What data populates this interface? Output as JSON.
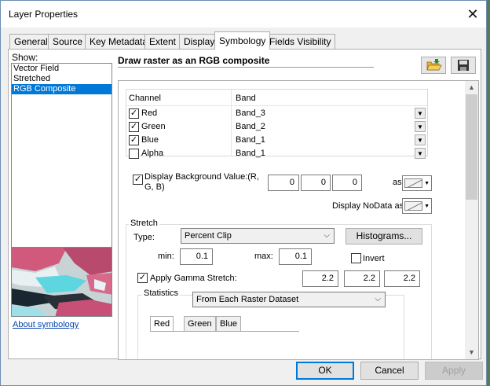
{
  "window": {
    "title": "Layer Properties"
  },
  "tabs": [
    "General",
    "Source",
    "Key Metadata",
    "Extent",
    "Display",
    "Symbology",
    "Fields Visibility"
  ],
  "active_tab": "Symbology",
  "show": {
    "label": "Show:",
    "items": [
      "Vector Field",
      "Stretched",
      "RGB Composite"
    ],
    "selected": "RGB Composite"
  },
  "about_link": "About symbology",
  "panel_title": "Draw raster as an RGB composite",
  "channel_table": {
    "headers": [
      "Channel",
      "Band"
    ],
    "rows": [
      {
        "channel": "Red",
        "band": "Band_3",
        "checked": true
      },
      {
        "channel": "Green",
        "band": "Band_2",
        "checked": true
      },
      {
        "channel": "Blue",
        "band": "Band_1",
        "checked": true
      },
      {
        "channel": "Alpha",
        "band": "Band_1",
        "checked": false
      }
    ]
  },
  "background": {
    "label": "Display Background Value:(R, G, B)",
    "checked": true,
    "values": [
      "0",
      "0",
      "0"
    ],
    "as_label": "as"
  },
  "nodata": {
    "label": "Display NoData as"
  },
  "stretch": {
    "group_label": "Stretch",
    "type_label": "Type:",
    "type_value": "Percent Clip",
    "histograms_button": "Histograms...",
    "min_label": "min:",
    "min_value": "0.1",
    "max_label": "max:",
    "max_value": "0.1",
    "invert_label": "Invert",
    "invert_checked": false,
    "gamma_label": "Apply Gamma Stretch:",
    "gamma_checked": true,
    "gamma_values": [
      "2.2",
      "2.2",
      "2.2"
    ]
  },
  "statistics": {
    "group_label": "Statistics",
    "value": "From Each Raster Dataset",
    "tabs": [
      "Red",
      "Green",
      "Blue"
    ],
    "active_tab": "Red"
  },
  "buttons": {
    "ok": "OK",
    "cancel": "Cancel",
    "apply": "Apply"
  },
  "colors": {
    "selection": "#0078d7",
    "link": "#0645ad"
  }
}
